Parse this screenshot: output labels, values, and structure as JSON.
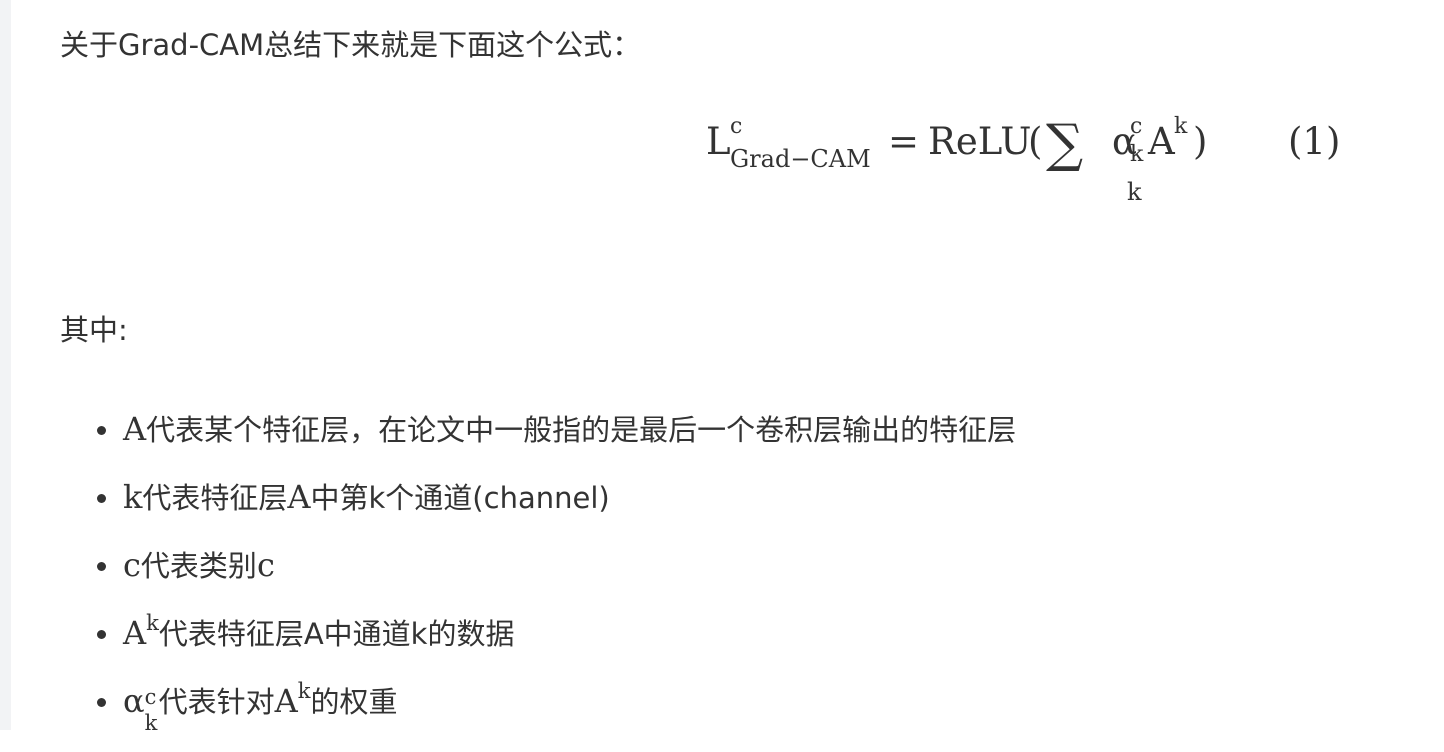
{
  "intro_text": "关于Grad-CAM总结下来就是下面这个公式：",
  "equation": {
    "lhs_base": "L",
    "lhs_sup": "c",
    "lhs_sub": "Grad−CAM",
    "equals": "=",
    "func": "ReLU",
    "lparen": "(",
    "sum_symbol": "∑",
    "sum_index": "k",
    "alpha": "α",
    "alpha_sup": "c",
    "alpha_sub": "k",
    "A": "A",
    "A_sup": "k",
    "rparen": ")",
    "number": "(1)"
  },
  "where_label": "其中:",
  "definitions": [
    {
      "math": "A",
      "text": "代表某个特征层，在论文中一般指的是最后一个卷积层输出的特征层"
    },
    {
      "math": "k",
      "text_a": "代表特征层",
      "math_b": "A",
      "text_b": "中第k个通道(channel)"
    },
    {
      "math": "c",
      "text_a": "代表类别",
      "math_b": "c"
    },
    {
      "math": "A",
      "sup": "k",
      "text": "代表特征层A中通道k的数据"
    },
    {
      "math": "α",
      "sup": "c",
      "sub": "k",
      "text_a": "代表针对",
      "math_b": "A",
      "sup_b": "k",
      "text_b": "的权重"
    }
  ]
}
